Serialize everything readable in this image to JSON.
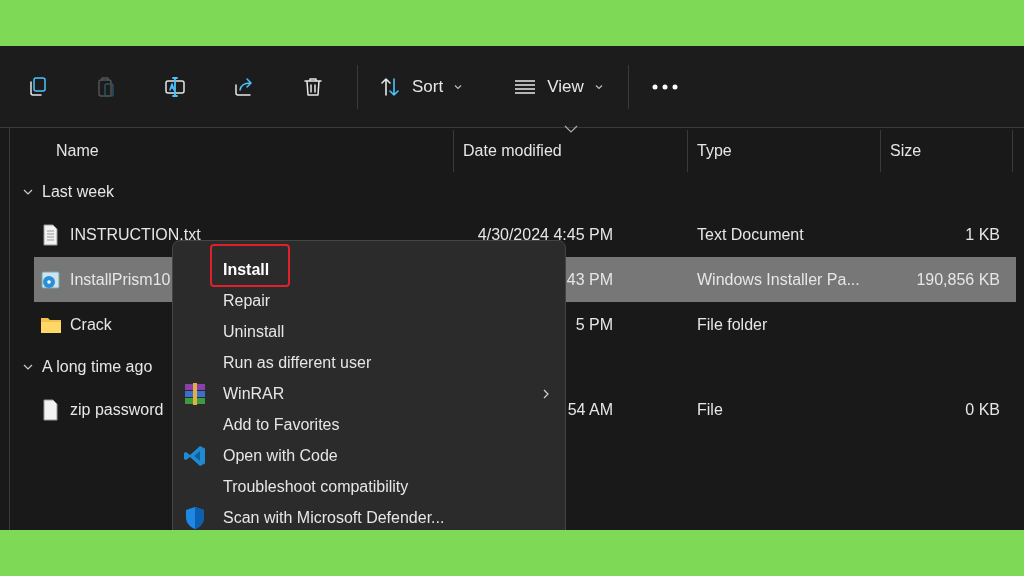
{
  "toolbar": {
    "buttons": [
      {
        "kind": "copy",
        "disabled": false
      },
      {
        "kind": "paste",
        "disabled": true
      },
      {
        "kind": "rename",
        "disabled": false
      },
      {
        "kind": "share",
        "disabled": false
      },
      {
        "kind": "delete",
        "disabled": false
      }
    ],
    "sort": "Sort",
    "view": "View"
  },
  "columns": [
    "Name",
    "Date modified",
    "Type",
    "Size"
  ],
  "groups": [
    {
      "label": "Last week",
      "expanded": true,
      "rows": [
        {
          "kind": "text",
          "name": "INSTRUCTION.txt",
          "date": "4/30/2024 4:45 PM",
          "type": "Text Document",
          "size": "1 KB",
          "selected": false
        },
        {
          "kind": "installer",
          "name": "InstallPrism10",
          "date": "43 PM",
          "type": "Windows Installer Pa...",
          "size": "190,856 KB",
          "selected": true
        },
        {
          "kind": "folder",
          "name": "Crack",
          "date": "5 PM",
          "type": "File folder",
          "size": "",
          "selected": false
        }
      ]
    },
    {
      "label": "A long time ago",
      "expanded": true,
      "rows": [
        {
          "kind": "file",
          "name": "zip password",
          "date": "54 AM",
          "type": "File",
          "size": "0 KB",
          "selected": false
        }
      ]
    }
  ],
  "context_menu": {
    "items": [
      {
        "kind": "plain",
        "label": "Install",
        "default": true,
        "highlighted": true,
        "submenu": false
      },
      {
        "kind": "plain",
        "label": "Repair",
        "default": false,
        "highlighted": false,
        "submenu": false
      },
      {
        "kind": "plain",
        "label": "Uninstall",
        "default": false,
        "highlighted": false,
        "submenu": false
      },
      {
        "kind": "plain",
        "label": "Run as different user",
        "default": false,
        "highlighted": false,
        "submenu": false
      },
      {
        "kind": "winrar",
        "label": "WinRAR",
        "default": false,
        "highlighted": false,
        "submenu": true
      },
      {
        "kind": "plain",
        "label": "Add to Favorites",
        "default": false,
        "highlighted": false,
        "submenu": false
      },
      {
        "kind": "vscode",
        "label": "Open with Code",
        "default": false,
        "highlighted": false,
        "submenu": false
      },
      {
        "kind": "plain",
        "label": "Troubleshoot compatibility",
        "default": false,
        "highlighted": false,
        "submenu": false
      },
      {
        "kind": "defender",
        "label": "Scan with Microsoft Defender...",
        "default": false,
        "highlighted": false,
        "submenu": false
      }
    ]
  }
}
